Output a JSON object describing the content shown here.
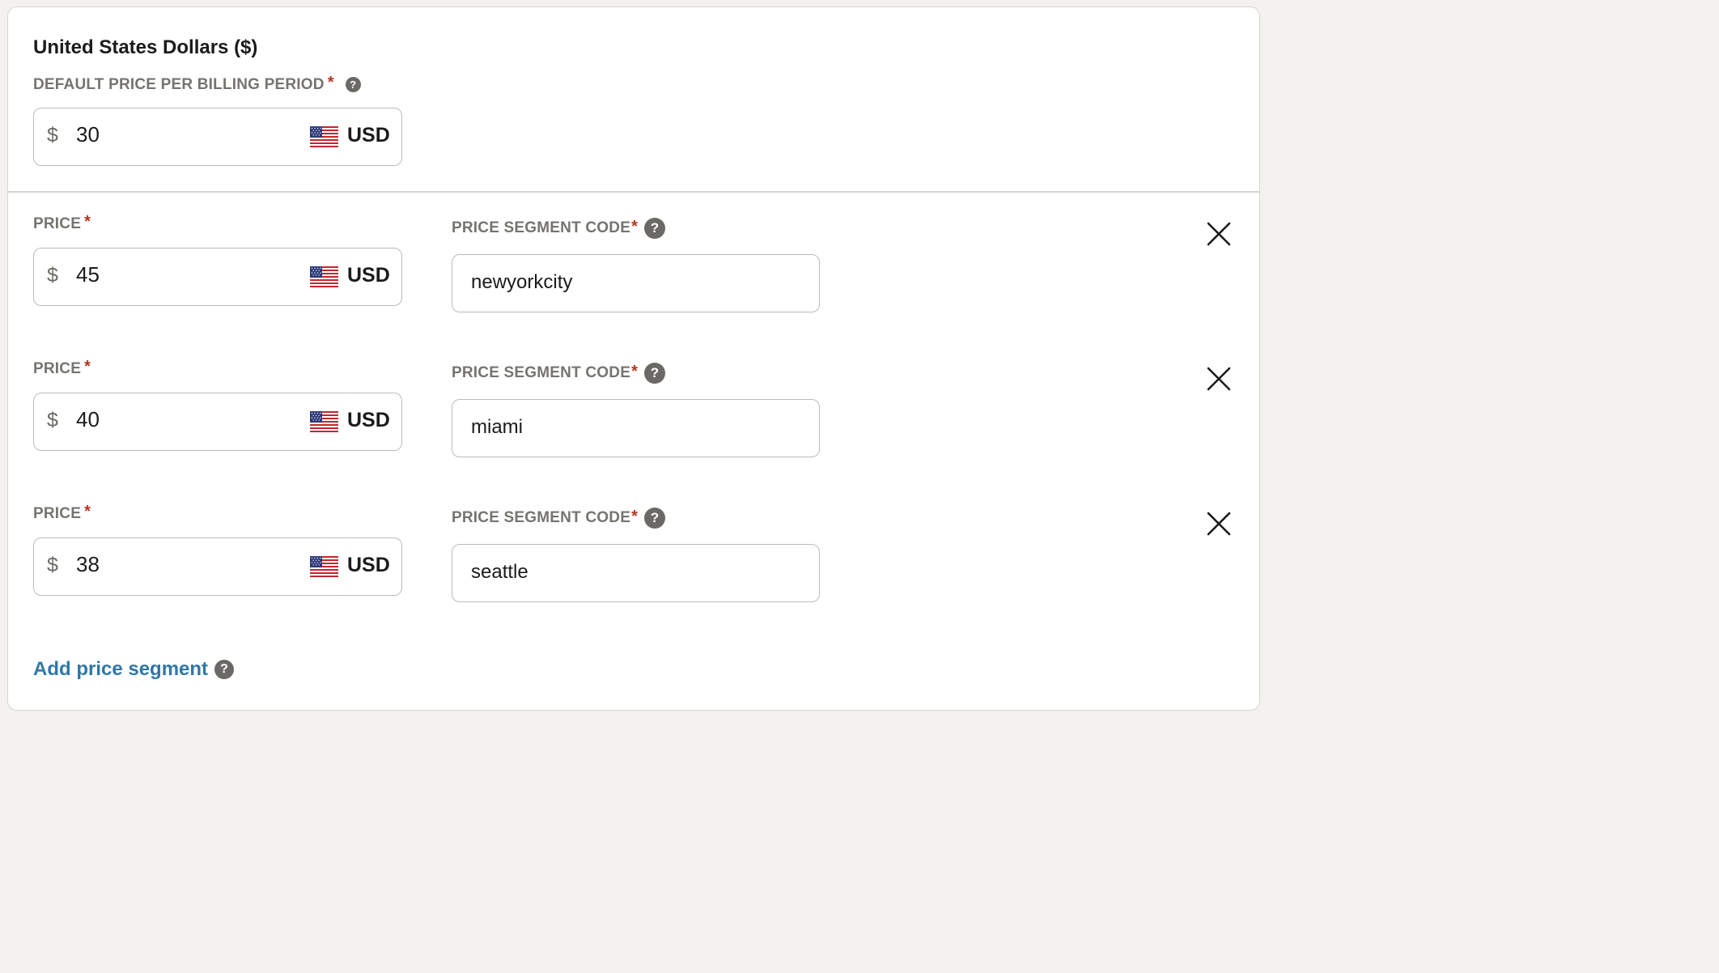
{
  "section": {
    "title": "United States Dollars ($)",
    "default_label": "DEFAULT PRICE PER BILLING PERIOD",
    "required_mark": "*",
    "help_glyph": "?",
    "default_price": {
      "symbol": "$",
      "value": "30",
      "currency": "USD",
      "flag_icon": "us-flag-icon"
    }
  },
  "segments": [
    {
      "price_label": "PRICE",
      "code_label": "PRICE SEGMENT CODE",
      "symbol": "$",
      "value": "45",
      "currency": "USD",
      "code": "newyorkcity"
    },
    {
      "price_label": "PRICE",
      "code_label": "PRICE SEGMENT CODE",
      "symbol": "$",
      "value": "40",
      "currency": "USD",
      "code": "miami"
    },
    {
      "price_label": "PRICE",
      "code_label": "PRICE SEGMENT CODE",
      "symbol": "$",
      "value": "38",
      "currency": "USD",
      "code": "seattle"
    }
  ],
  "add_segment_label": "Add price segment",
  "colors": {
    "label_gray": "#76746f",
    "required_red": "#b8341f",
    "link_blue": "#2f78a8",
    "border": "#bdbbb6"
  }
}
